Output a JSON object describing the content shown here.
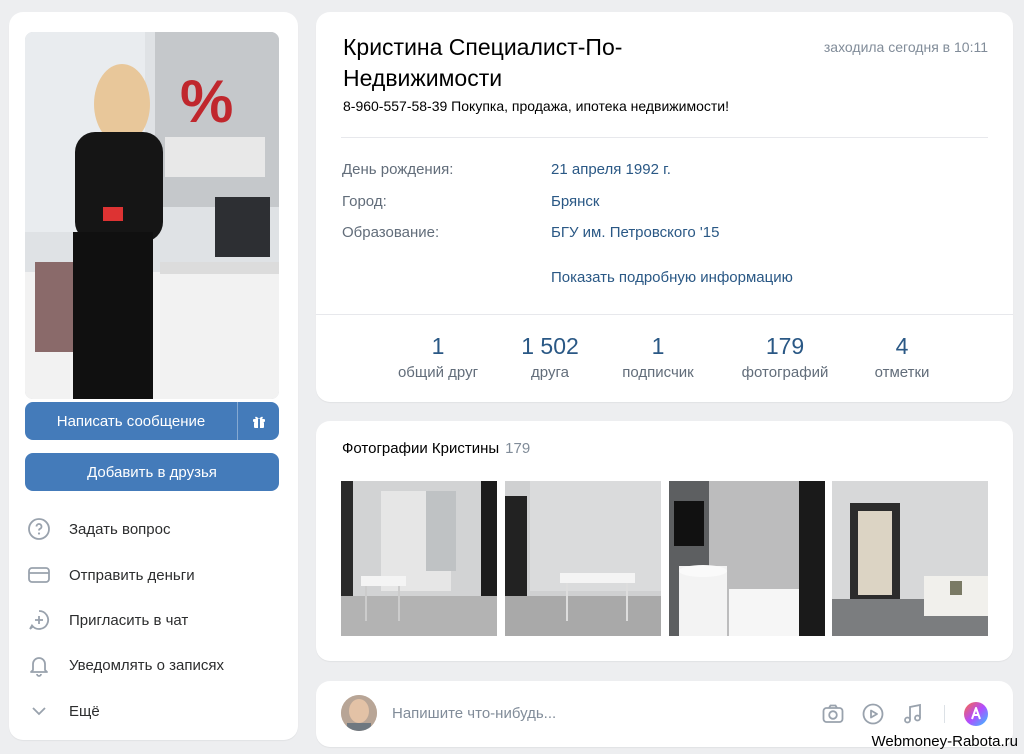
{
  "profile": {
    "name": "Кристина Специалист-По-Недвижимости",
    "last_seen": "заходила сегодня в 10:11",
    "status": "8-960-557-58-39 Покупка, продажа, ипотека недвижимости!",
    "info": [
      {
        "label": "День рождения:",
        "value": "21 апреля 1992 г."
      },
      {
        "label": "Город:",
        "value": "Брянск"
      },
      {
        "label": "Образование:",
        "value": "БГУ им. Петровского '15"
      }
    ],
    "more_info": "Показать подробную информацию",
    "counters": [
      {
        "num": "1",
        "label": "общий друг"
      },
      {
        "num": "1 502",
        "label": "друга"
      },
      {
        "num": "1",
        "label": "подписчик"
      },
      {
        "num": "179",
        "label": "фотографий"
      },
      {
        "num": "4",
        "label": "отметки"
      }
    ]
  },
  "left": {
    "write_message": "Написать сообщение",
    "add_friend": "Добавить в друзья",
    "actions": [
      {
        "label": "Задать вопрос",
        "icon": "question-icon"
      },
      {
        "label": "Отправить деньги",
        "icon": "money-card-icon"
      },
      {
        "label": "Пригласить в чат",
        "icon": "chat-plus-icon"
      },
      {
        "label": "Уведомлять о записях",
        "icon": "bell-icon"
      },
      {
        "label": "Ещё",
        "icon": "chevron-down-icon"
      }
    ]
  },
  "photos": {
    "title": "Фотографии Кристины",
    "count": "179"
  },
  "post": {
    "placeholder": "Напишите что-нибудь..."
  },
  "watermark": "Webmoney-Rabota.ru",
  "colors": {
    "accent": "#447bba",
    "link": "#2a5885",
    "background": "#edeef0"
  }
}
